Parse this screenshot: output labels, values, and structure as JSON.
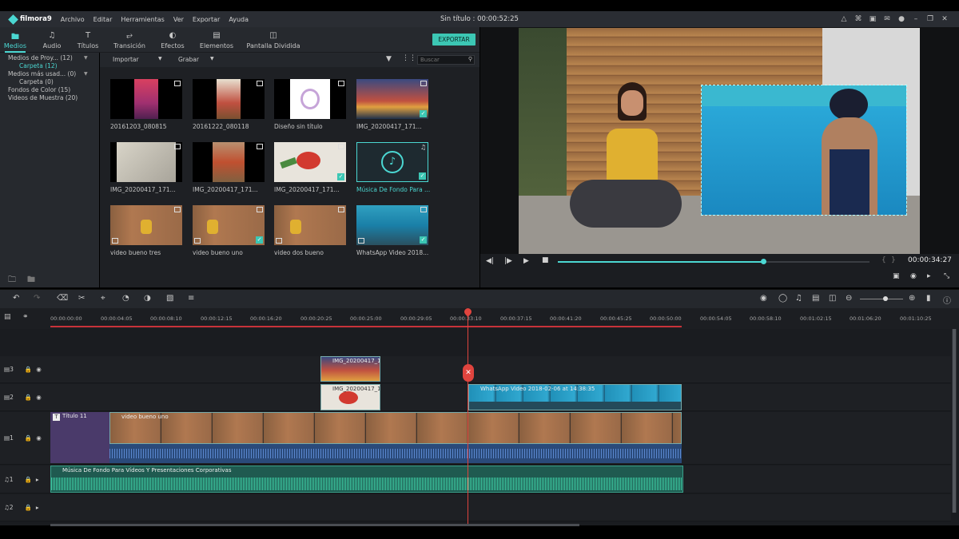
{
  "app": {
    "name": "filmora9",
    "doc_title": "Sin título : 00:00:52:25"
  },
  "menu": [
    "Archivo",
    "Editar",
    "Herramientas",
    "Ver",
    "Exportar",
    "Ayuda"
  ],
  "tabs": [
    {
      "label": "Medios",
      "icon": "folder-icon"
    },
    {
      "label": "Audio",
      "icon": "music-note-icon"
    },
    {
      "label": "Títulos",
      "icon": "text-icon"
    },
    {
      "label": "Transición",
      "icon": "transition-icon"
    },
    {
      "label": "Efectos",
      "icon": "effects-icon"
    },
    {
      "label": "Elementos",
      "icon": "image-icon"
    },
    {
      "label": "Pantalla Dividida",
      "icon": "split-screen-icon"
    }
  ],
  "export_label": "EXPORTAR",
  "sidebar": [
    {
      "label": "Medios de Proy... (12)"
    },
    {
      "label": "Carpeta (12)"
    },
    {
      "label": "Medios más usad... (0)"
    },
    {
      "label": "Carpeta (0)"
    },
    {
      "label": "Fondos de Color (15)"
    },
    {
      "label": "Videos de Muestra (20)"
    }
  ],
  "media_toolbar": {
    "import": "Importar",
    "record": "Grabar",
    "search_placeholder": "Buscar"
  },
  "media": [
    {
      "label": "20161203_080815"
    },
    {
      "label": "20161222_080118"
    },
    {
      "label": "Diseño sin título"
    },
    {
      "label": "IMG_20200417_171..."
    },
    {
      "label": "IMG_20200417_171..."
    },
    {
      "label": "IMG_20200417_171..."
    },
    {
      "label": "IMG_20200417_171..."
    },
    {
      "label": "Música De Fondo Para ..."
    },
    {
      "label": "video bueno tres"
    },
    {
      "label": "video bueno uno"
    },
    {
      "label": "video dos bueno"
    },
    {
      "label": "WhatsApp Video 2018..."
    }
  ],
  "player": {
    "timecode": "00:00:34:27",
    "progress": 0.66
  },
  "ruler": [
    "00:00:00:00",
    "00:00:04:05",
    "00:00:08:10",
    "00:00:12:15",
    "00:00:16:20",
    "00:00:20:25",
    "00:00:25:00",
    "00:00:29:05",
    "00:00:33:10",
    "00:00:37:15",
    "00:00:41:20",
    "00:00:45:25",
    "00:00:50:00",
    "00:00:54:05",
    "00:00:58:10",
    "00:01:02:15",
    "00:01:06:20",
    "00:01:10:25"
  ],
  "tracks": {
    "v3": {
      "label": "3",
      "clip": "IMG_20200417_17..."
    },
    "v2": {
      "label": "2",
      "clip_a": "IMG_20200417_17...",
      "clip_b": "WhatsApp Video 2018-02-06 at 14:38:35"
    },
    "v1": {
      "label": "1",
      "title_clip": "Título 11",
      "video_clip": "video bueno uno"
    },
    "a1": {
      "label": "1",
      "clip": "Música De Fondo Para Vídeos Y Presentaciones Corporativas"
    },
    "a2": {
      "label": "2"
    }
  },
  "colors": {
    "accent": "#4bd7d2",
    "export": "#3cc7b4",
    "playhead": "#e0443e",
    "audio": "#3aa08a"
  }
}
